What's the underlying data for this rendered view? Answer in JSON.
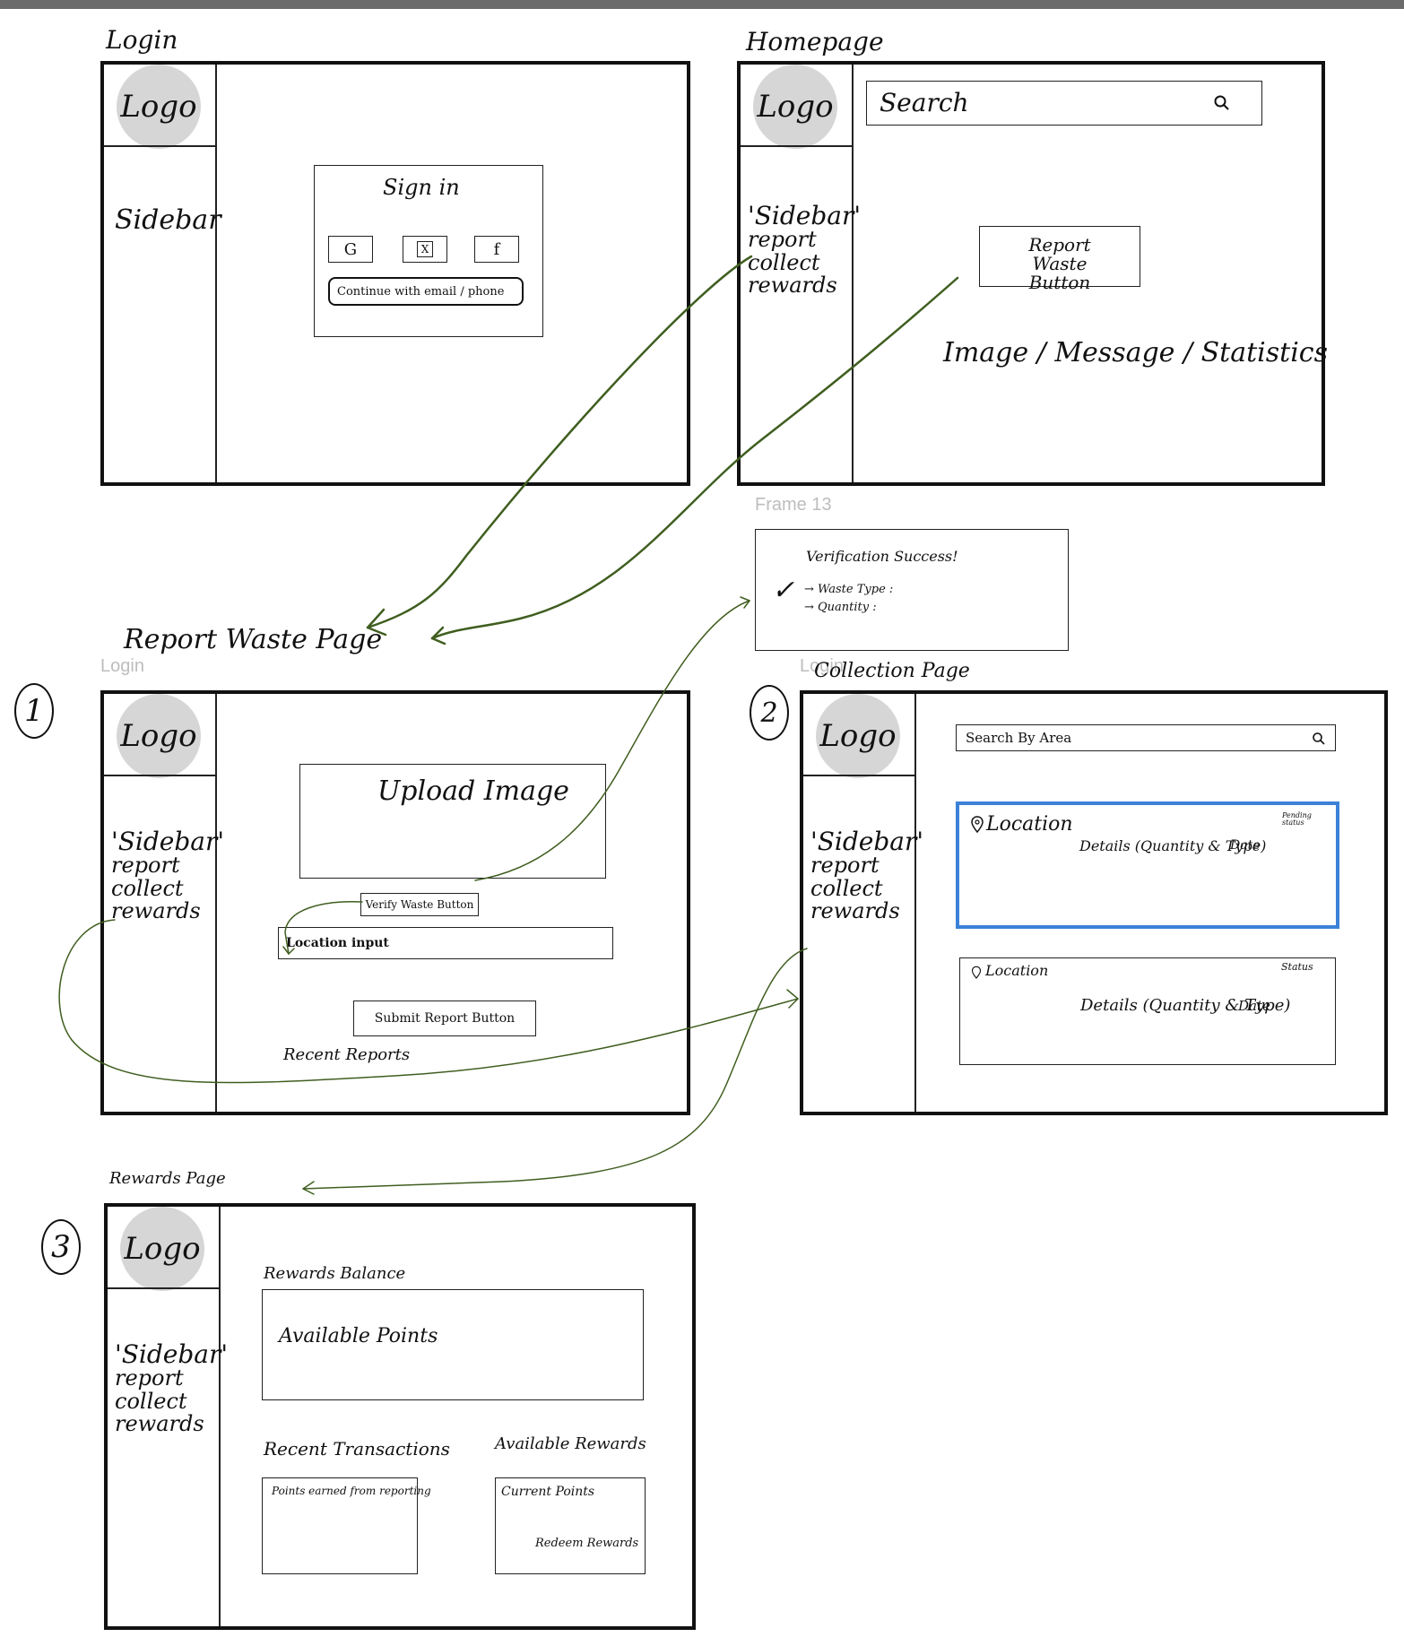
{
  "login": {
    "title": "Login",
    "logo": "Logo",
    "sidebar": "Sidebar",
    "signin": {
      "title": "Sign in",
      "google": "G",
      "x": "X",
      "facebook": "f",
      "continue": "Continue with email / phone"
    }
  },
  "homepage": {
    "title": "Homepage",
    "logo": "Logo",
    "search_placeholder": "Search",
    "sidebar_title": "'Sidebar'",
    "sidebar_items": [
      "report",
      "collect",
      "rewards"
    ],
    "report_button": "Report Waste Button",
    "content_text": "Image / Message / Statistics"
  },
  "frame13": {
    "label": "Frame 13",
    "title": "Verification Success!",
    "check": "✓",
    "line1": "→ Waste Type :",
    "line2": "→ Quantity :"
  },
  "report": {
    "title": "Report Waste Page",
    "gray_label": "Login",
    "number": "1",
    "logo": "Logo",
    "sidebar_title": "'Sidebar'",
    "sidebar_items": [
      "report",
      "collect",
      "rewards"
    ],
    "upload": "Upload Image",
    "verify_button": "Verify Waste Button",
    "location_input": "Location input",
    "submit_button": "Submit Report Button",
    "recent": "Recent Reports"
  },
  "collection": {
    "title": "Collection Page",
    "gray_label": "Login",
    "number": "2",
    "logo": "Logo",
    "sidebar_title": "'Sidebar'",
    "sidebar_items": [
      "report",
      "collect",
      "rewards"
    ],
    "search_placeholder": "Search By Area",
    "cards": [
      {
        "location": "Location",
        "details": "Details (Quantity & Type)",
        "date": "Date",
        "status": "Pending status"
      },
      {
        "location": "Location",
        "details": "Details (Quantity & Type)",
        "date": "Date",
        "status": "Status"
      }
    ]
  },
  "rewards": {
    "title": "Rewards Page",
    "number": "3",
    "logo": "Logo",
    "sidebar_title": "'Sidebar'",
    "sidebar_items": [
      "report",
      "collect",
      "rewards"
    ],
    "balance_label": "Rewards Balance",
    "available_points": "Available Points",
    "transactions_label": "Recent Transactions",
    "transaction_item": "Points earned from reporting",
    "available_label": "Available Rewards",
    "current_points": "Current Points",
    "redeem": "Redeem Rewards"
  },
  "colors": {
    "arrow": "#3f5e1f",
    "logo_fill": "#d6d6d6",
    "selected_card": "#3b82d8"
  }
}
